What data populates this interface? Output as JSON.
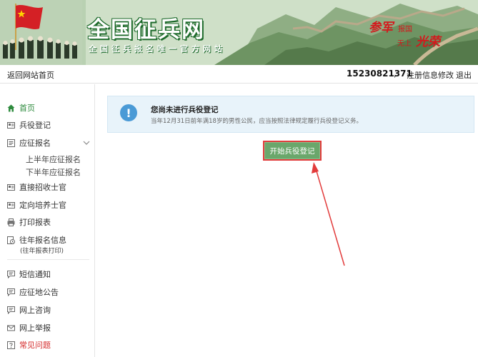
{
  "banner": {
    "title": "全国征兵网",
    "subtitle": "全国征兵报名唯一官方网站",
    "slogan": {
      "part1": "参军",
      "part2": "报国",
      "part3": "无上",
      "part4": "光荣"
    }
  },
  "topbar": {
    "home_link": "返回网站首页",
    "user_phone": "15230821371",
    "comma": ",",
    "edit_profile": "注册信息修改",
    "logout": "退出"
  },
  "sidebar": {
    "items": [
      {
        "label": "首页",
        "icon": "home-icon"
      },
      {
        "label": "兵役登记",
        "icon": "id-card-icon"
      },
      {
        "label": "应征报名",
        "icon": "form-icon"
      },
      {
        "label": "直接招收士官",
        "icon": "id-card-icon"
      },
      {
        "label": "定向培养士官",
        "icon": "id-card-icon"
      },
      {
        "label": "打印报表",
        "icon": "printer-icon"
      },
      {
        "label": "往年报名信息",
        "icon": "history-icon",
        "note": "(往年报表打印)"
      },
      {
        "label": "短信通知",
        "icon": "chat-icon"
      },
      {
        "label": "应征地公告",
        "icon": "chat-icon"
      },
      {
        "label": "网上咨询",
        "icon": "chat-icon"
      },
      {
        "label": "网上举报",
        "icon": "mail-icon"
      },
      {
        "label": "常见问题",
        "icon": "help-icon"
      }
    ],
    "sub_items": [
      "上半年应征报名",
      "下半年应征报名"
    ]
  },
  "notice": {
    "icon_glyph": "!",
    "title": "您尚未进行兵役登记",
    "text": "当年12月31日前年满18岁的男性公民，应当按照法律规定履行兵役登记义务。"
  },
  "actions": {
    "start_registration": "开始兵役登记"
  },
  "colors": {
    "accent_green": "#2e8b3e",
    "button_green": "#6aa76b",
    "highlight_red": "#e23b3b",
    "info_blue": "#4a9ad6"
  }
}
